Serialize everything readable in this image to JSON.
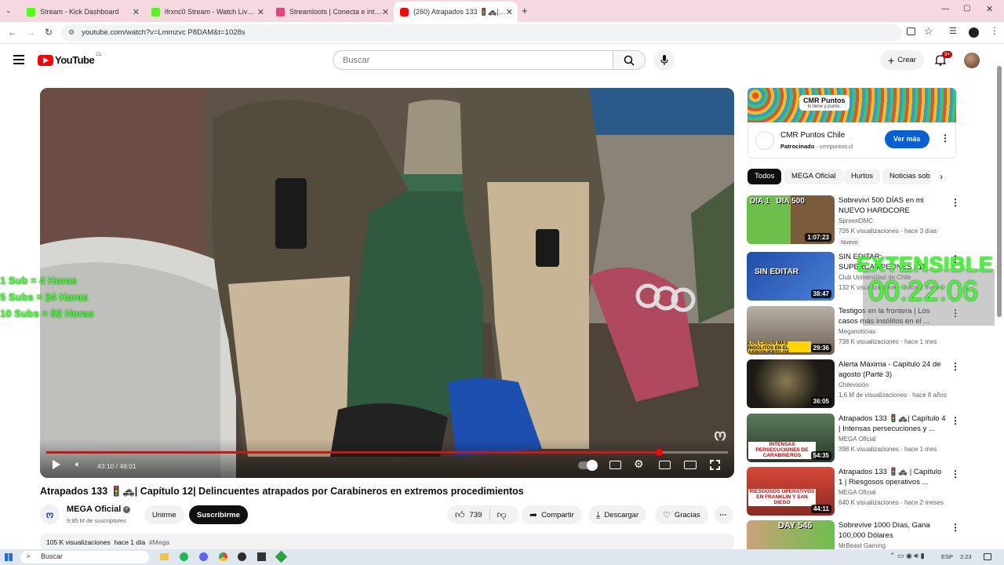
{
  "browser": {
    "tabs": [
      {
        "title": "Stream - Kick Dashboard",
        "favicon_color": "#53fc18"
      },
      {
        "title": "ifrxnc0 Stream - Watch Live on",
        "favicon_color": "#53fc18"
      },
      {
        "title": "Streamloots | Conecta e interac",
        "favicon_color": "#e0457b"
      },
      {
        "title": "(260) Atrapados 133 🚦🚓| Capí",
        "favicon_color": "#ff0000"
      }
    ],
    "new_tab": "+",
    "url": "youtube.com/watch?v=Lmmzvc P8DAM&t=1028s"
  },
  "youtube": {
    "logo_text": "YouTube",
    "logo_country": "CL",
    "search_placeholder": "Buscar",
    "create_label": "Crear",
    "notif_count": "9+"
  },
  "player": {
    "time": "43:10 / 48:01",
    "progress": 0.899
  },
  "video": {
    "title": "Atrapados 133 🚦🚓| Capítulo 12| Delincuentes atrapados por Carabineros en extremos procedimientos",
    "channel": "MEGA Oficial",
    "subscribers": "9,95 M de suscriptores",
    "join_label": "Unirme",
    "subscribe_label": "Suscribirme",
    "likes": "739",
    "share_label": "Compartir",
    "download_label": "Descargar",
    "thanks_label": "Gracias",
    "views": "105 K visualizaciones",
    "age": "hace 1 día",
    "hashtag": "#Mega"
  },
  "ad": {
    "banner_title": "CMR Puntos",
    "banner_sub": "lo tiene y punto.",
    "name": "CMR Puntos Chile",
    "sponsored": "Patrocinado",
    "domain": "cmrpuntos.cl",
    "cta": "Ver más"
  },
  "chips": [
    "Todos",
    "MEGA Oficial",
    "Hurtos",
    "Noticias sob"
  ],
  "recommendations": [
    {
      "title": "Sobreviví 500 DÍAS en mi NUEVO HARDCORE",
      "channel": "SpreenDMC",
      "meta": "726 K visualizaciones · hace 3 días",
      "badge": "Nuevo",
      "duration": "1:07:23",
      "thumb_text": "DIA 1   DIA 500"
    },
    {
      "title": "SIN EDITAR: SUPERCAMPEONES #12",
      "channel": "Club Universidad de Chile",
      "meta": "132 K visualizaciones · hace 2 meses",
      "badge": "",
      "duration": "38:47",
      "thumb_text": "SIN EDITAR"
    },
    {
      "title": "Testigos en la frontera | Los casos más insólitos en el ...",
      "channel": "Meganoticias",
      "meta": "738 K visualizaciones · hace 1 mes",
      "badge": "",
      "duration": "29:36",
      "thumb_text": "LOS CASOS MÁS INSÓLITOS EN EL AEROPUERTO DE SANTIAGO"
    },
    {
      "title": "Alerta Máxima - Capitulo 24 de agosto (Parte 3)",
      "channel": "Chilevisión",
      "meta": "1,6 M de visualizaciones · hace 8 años",
      "badge": "",
      "duration": "36:05",
      "thumb_text": ""
    },
    {
      "title": "Atrapados 133 🚦🚓| Capítulo 4 | Intensas persecuciones y ...",
      "channel": "MEGA Oficial",
      "meta": "398 K visualizaciones · hace 1 mes",
      "badge": "",
      "duration": "54:35",
      "thumb_text": "INTENSAS PERSECUCIONES DE CARABINEROS"
    },
    {
      "title": "Atrapados 133 🚦🚓 | Capítulo 1 | Riesgosos operativos ...",
      "channel": "MEGA Oficial",
      "meta": "640 K visualizaciones · hace 2 meses",
      "badge": "",
      "duration": "44:11",
      "thumb_text": "RIESGOSOS OPERATIVOS EN FRANKLIN Y SAN DIEGO"
    },
    {
      "title": "Sobrevive 1000 Días, Gana 100,000 Dólares",
      "channel": "MrBeast Gaming",
      "meta": "",
      "badge": "",
      "duration": "",
      "thumb_text": "DAY 546"
    }
  ],
  "overlay": {
    "sub_lines": [
      "1 Sub = 4 Horas",
      "5 Subs = 24 Horas",
      "10 Subs = 52 Horas"
    ],
    "extensible": "EXTENSIBLE",
    "timer": "00:22:06"
  },
  "taskbar": {
    "search": "Buscar",
    "lang": "ESP",
    "time": "2:23"
  }
}
